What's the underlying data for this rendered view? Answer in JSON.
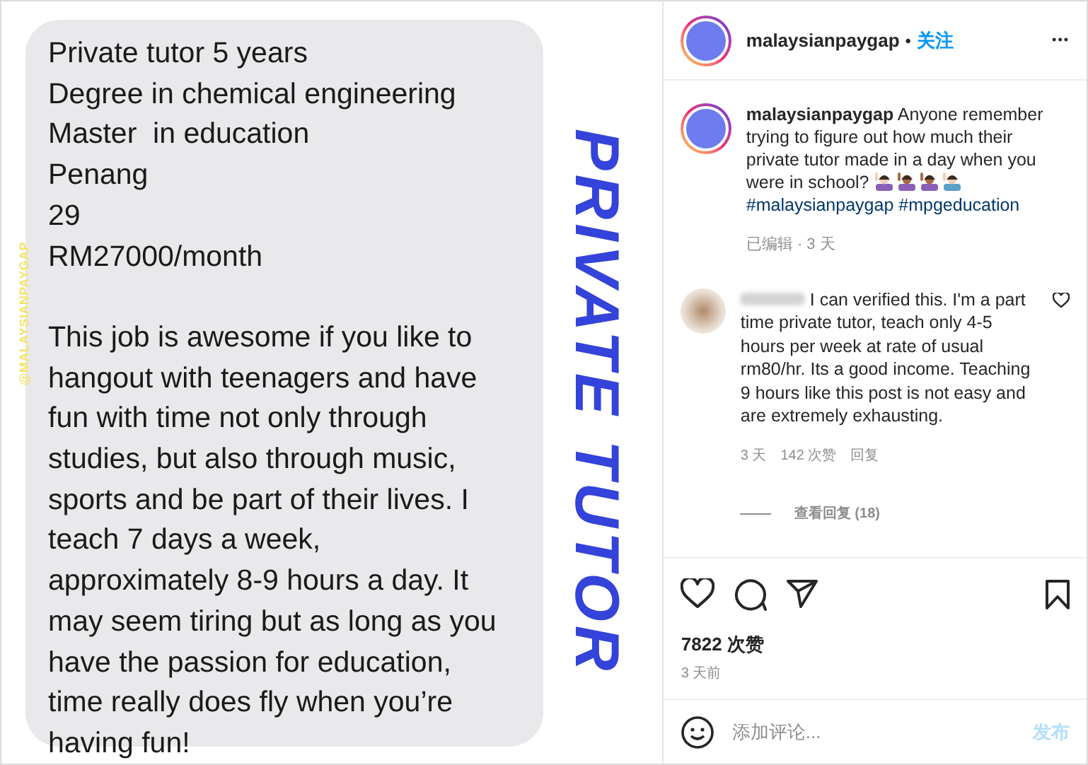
{
  "post_image": {
    "message_lines": [
      [
        "Private tutor 5 years",
        "Degree in chemical engineering",
        "Master  in education",
        "Penang",
        "29",
        "RM27000/month"
      ],
      [
        "This job is awesome if you like to",
        "hangout with teenagers and have",
        "fun with time not only through",
        "studies, but also through music,",
        "sports and be part of their lives. I",
        "teach 7 days a week,",
        "approximately 8-9 hours a day. It",
        "may seem tiring but as long as you",
        "have the passion for education,",
        "time really does fly when you’re",
        "having fun!"
      ]
    ],
    "side_tag": "@MALAYSIANPAYGAP",
    "title": "PRIVATE TUTOR"
  },
  "header": {
    "username": "malaysianpaygap",
    "separator": "•",
    "follow": "关注",
    "more": "•••"
  },
  "caption": {
    "username": "malaysianpaygap",
    "text": "Anyone remember trying to figure out how much their private tutor made in a day when you were in school?",
    "hashtags": [
      "#malaysianpaygap",
      "#mpgeducation"
    ],
    "meta": "已编辑 · 3 天"
  },
  "comments": [
    {
      "username_hidden": true,
      "text": "I can verified this. I'm a part time private tutor, teach only 4-5 hours per week at rate of usual rm80/hr. Its a good income. Teaching 9 hours like this post is not easy and are extremely exhausting.",
      "time": "3 天",
      "likes": "142 次赞",
      "reply": "回复",
      "liked": false,
      "view_replies": "查看回复 (18)"
    }
  ],
  "actions": {
    "liked": false,
    "saved": false
  },
  "likes": "7822 次赞",
  "posted": "3 天前",
  "comment_box": {
    "placeholder": "添加评论...",
    "post": "发布"
  }
}
